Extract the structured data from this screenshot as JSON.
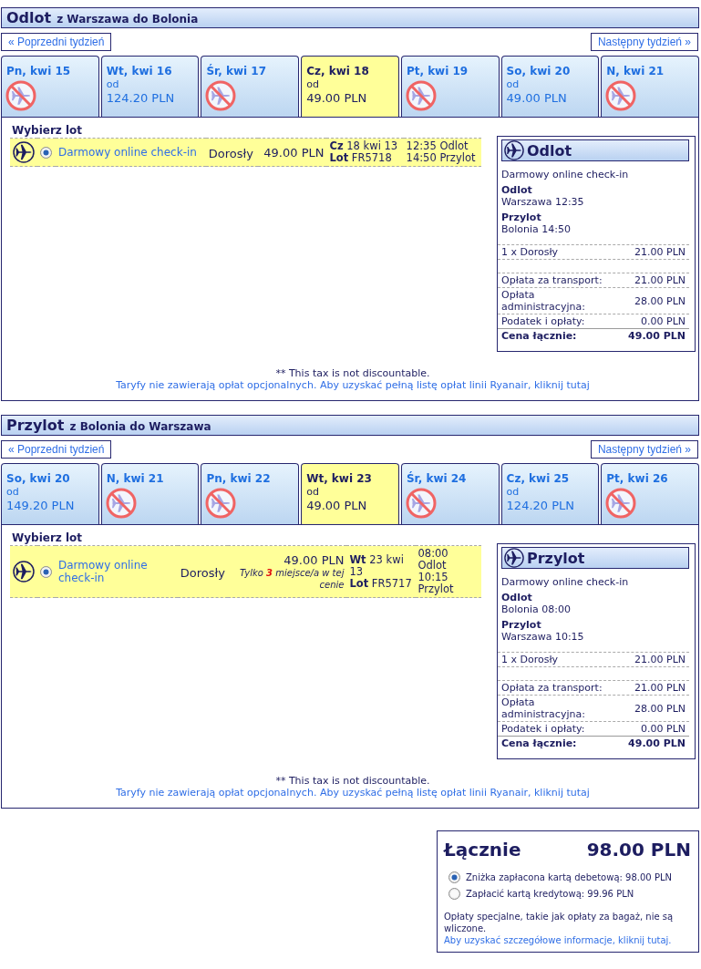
{
  "journeys": [
    {
      "title": "Odlot",
      "route": "z Warszawa do Bolonia",
      "prev_week": "« Poprzedni tydzień",
      "next_week": "Następny tydzień »",
      "days": [
        {
          "label": "Pn, kwi 15",
          "kind": "none",
          "selected": false
        },
        {
          "label": "Wt, kwi 16",
          "kind": "fare",
          "from": "od",
          "price": "124.20 PLN",
          "selected": false
        },
        {
          "label": "Śr, kwi 17",
          "kind": "none",
          "selected": false
        },
        {
          "label": "Cz, kwi 18",
          "kind": "fare",
          "from": "od",
          "price": "49.00 PLN",
          "selected": true
        },
        {
          "label": "Pt, kwi 19",
          "kind": "none",
          "selected": false
        },
        {
          "label": "So, kwi 20",
          "kind": "fare",
          "from": "od",
          "price": "49.00 PLN",
          "selected": false
        },
        {
          "label": "N, kwi 21",
          "kind": "none",
          "selected": false
        }
      ],
      "choose_label": "Wybierz lot",
      "flights": [
        {
          "selected": true,
          "fare_name": "Darmowy online check-in",
          "passenger": "Dorosły",
          "price": "49.00 PLN",
          "date": "**Cz** 18 kwi 13",
          "flight_no": "**Lot** FR5718",
          "departure": "12:35 Odlot",
          "arrival": "14:50 Przylot"
        }
      ],
      "summary": {
        "title": "Odlot",
        "fare_name": "Darmowy online check-in",
        "stops": [
          {
            "label": "Odlot",
            "value": "Warszawa 12:35"
          },
          {
            "label": "Przylot",
            "value": "Bolonia 14:50"
          }
        ],
        "passengers": [
          {
            "label": "1 x Dorosły",
            "amount": "21.00 PLN"
          }
        ],
        "charges": [
          {
            "label": "Opłata za transport:",
            "amount": "21.00 PLN"
          },
          {
            "label": "Opłata administracyjna:",
            "amount": "28.00 PLN"
          },
          {
            "label": "Podatek i opłaty:",
            "amount": "0.00 PLN"
          }
        ],
        "total": {
          "label": "Cena łącznie:",
          "amount": "49.00 PLN"
        }
      },
      "tax_note": "** This tax is not discountable.",
      "fees_link": "Taryfy nie zawierają opłat opcjonalnych. Aby uzyskać pełną listę opłat linii Ryanair, kliknij tutaj"
    },
    {
      "title": "Przylot",
      "route": "z Bolonia do Warszawa",
      "prev_week": "« Poprzedni tydzień",
      "next_week": "Następny tydzień »",
      "days": [
        {
          "label": "So, kwi 20",
          "kind": "fare",
          "from": "od",
          "price": "149.20 PLN",
          "selected": false
        },
        {
          "label": "N, kwi 21",
          "kind": "none",
          "selected": false
        },
        {
          "label": "Pn, kwi 22",
          "kind": "none",
          "selected": false
        },
        {
          "label": "Wt, kwi 23",
          "kind": "fare",
          "from": "od",
          "price": "49.00 PLN",
          "selected": true
        },
        {
          "label": "Śr, kwi 24",
          "kind": "none",
          "selected": false
        },
        {
          "label": "Cz, kwi 25",
          "kind": "fare",
          "from": "od",
          "price": "124.20 PLN",
          "selected": false
        },
        {
          "label": "Pt, kwi 26",
          "kind": "none",
          "selected": false
        }
      ],
      "choose_label": "Wybierz lot",
      "flights": [
        {
          "selected": true,
          "fare_name": "Darmowy online check-in",
          "passenger": "Dorosły",
          "price": "49.00 PLN",
          "note": "Tylko **3** miejsce/a w tej cenie",
          "date": "**Wt** 23 kwi 13",
          "flight_no": "**Lot** FR5717",
          "departure": "08:00 Odlot",
          "arrival": "10:15 Przylot"
        }
      ],
      "summary": {
        "title": "Przylot",
        "fare_name": "Darmowy online check-in",
        "stops": [
          {
            "label": "Odlot",
            "value": "Bolonia 08:00"
          },
          {
            "label": "Przylot",
            "value": "Warszawa 10:15"
          }
        ],
        "passengers": [
          {
            "label": "1 x Dorosły",
            "amount": "21.00 PLN"
          }
        ],
        "charges": [
          {
            "label": "Opłata za transport:",
            "amount": "21.00 PLN"
          },
          {
            "label": "Opłata administracyjna:",
            "amount": "28.00 PLN"
          },
          {
            "label": "Podatek i opłaty:",
            "amount": "0.00 PLN"
          }
        ],
        "total": {
          "label": "Cena łącznie:",
          "amount": "49.00 PLN"
        }
      },
      "tax_note": "** This tax is not discountable.",
      "fees_link": "Taryfy nie zawierają opłat opcjonalnych. Aby uzyskać pełną listę opłat linii Ryanair, kliknij tutaj"
    }
  ],
  "total": {
    "label": "Łącznie",
    "amount": "98.00 PLN",
    "payment_options": [
      {
        "label": "Zniżka zapłacona kartą debetową: 98.00 PLN",
        "selected": true
      },
      {
        "label": "Zapłacić kartą kredytową: 99.96 PLN",
        "selected": false
      }
    ],
    "note": "Opłaty specjalne, takie jak opłaty za bagaż, nie są wliczone.",
    "link": "Aby uzyskać szczegółowe informacje, kliknij tutaj."
  }
}
